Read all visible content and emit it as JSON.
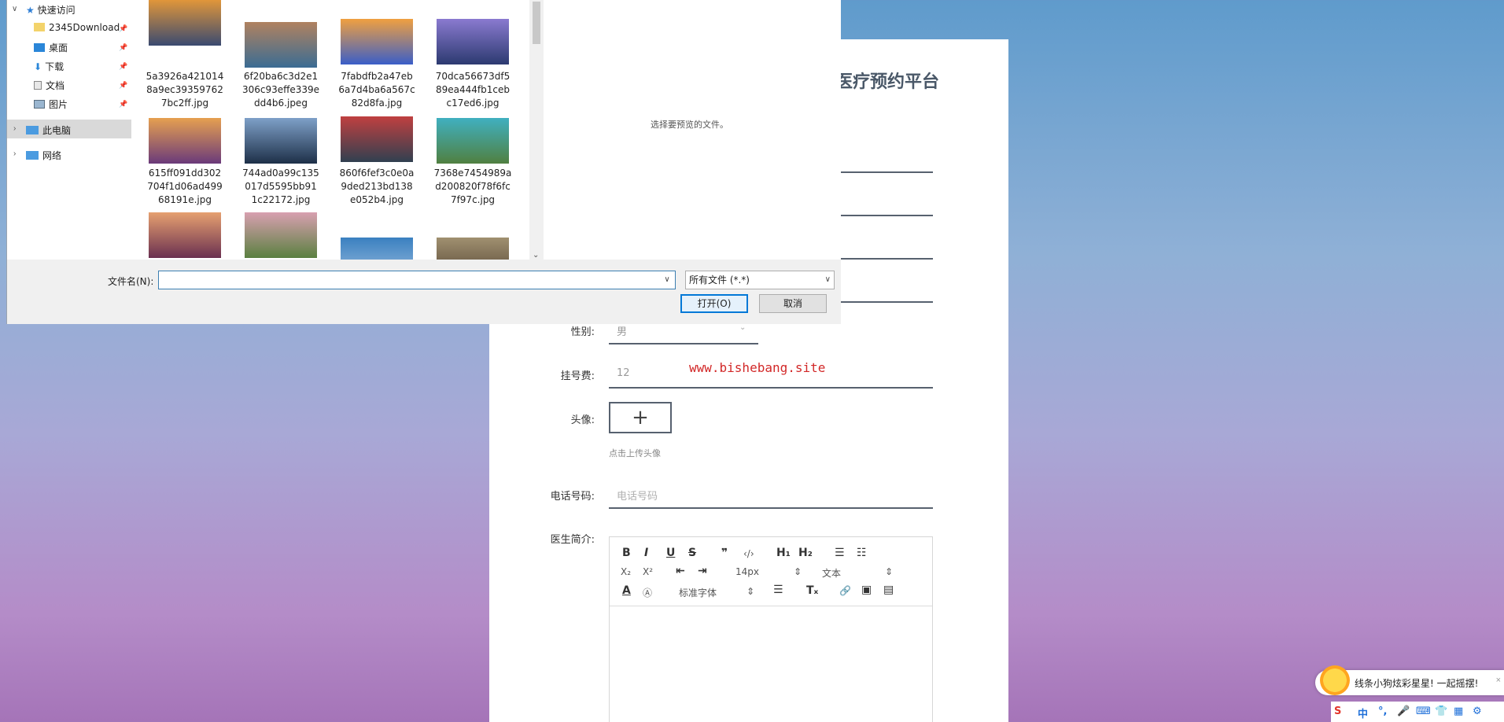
{
  "dialog": {
    "nav": {
      "quick_access": "快速访问",
      "downloads_folder": "2345Download",
      "desktop": "桌面",
      "downloads": "下载",
      "documents": "文档",
      "pictures": "图片",
      "this_pc": "此电脑",
      "network": "网络"
    },
    "files": [
      {
        "name": "5a3926a421014\n8a9ec39359762\n7bc2ff.jpg",
        "color1": "#e0963a",
        "color2": "#3a4a70"
      },
      {
        "name": "6f20ba6c3d2e1\n306c93effe339e\ndd4b6.jpeg",
        "color1": "#b08260",
        "color2": "#3b6c93"
      },
      {
        "name": "7fabdfb2a47eb\n6a7d4ba6a567c\n82d8fa.jpg",
        "color1": "#f0a040",
        "color2": "#3a5ec8"
      },
      {
        "name": "70dca56673df5\n89ea444fb1ceb\nc17ed6.jpg",
        "color1": "#8a7ad0",
        "color2": "#2c3a70"
      },
      {
        "name": "615ff091dd302\n704f1d06ad499\n68191e.jpg",
        "color1": "#e6a050",
        "color2": "#6a3a7a"
      },
      {
        "name": "744ad0a99c135\n017d5595bb91\n1c22172.jpg",
        "color1": "#7ea0c8",
        "color2": "#1e3048"
      },
      {
        "name": "860f6fef3c0e0a\n9ded213bd138\ne052b4.jpg",
        "color1": "#c04040",
        "color2": "#304050"
      },
      {
        "name": "7368e7454989a\nd200820f78f6fc\n7f97c.jpg",
        "color1": "#40b0c0",
        "color2": "#508040"
      },
      {
        "name": "",
        "color1": "#e6a070",
        "color2": "#6a3050"
      },
      {
        "name": "",
        "color1": "#d8a0b0",
        "color2": "#5a8040"
      },
      {
        "name": "",
        "color1": "#3a80c0",
        "color2": "#a0c0e0"
      },
      {
        "name": "",
        "color1": "#a09070",
        "color2": "#504030"
      }
    ],
    "preview_hint": "选择要预览的文件。",
    "filename_label": "文件名(N):",
    "filename_value": "",
    "filter_value": "所有文件 (*.*)",
    "open_button": "打开(O)",
    "cancel_button": "取消"
  },
  "form": {
    "title": "医疗预约平台",
    "gender_label": "性别:",
    "gender_value": "男",
    "fee_label": "挂号费:",
    "fee_value": "12",
    "avatar_label": "头像:",
    "upload_plus": "+",
    "upload_hint": "点击上传头像",
    "phone_label": "电话号码:",
    "phone_placeholder": "电话号码",
    "intro_label": "医生简介:",
    "editor": {
      "bold": "B",
      "italic": "I",
      "underline": "U",
      "strike": "S",
      "quote": "❞",
      "code": "‹/›",
      "h1": "H₁",
      "h2": "H₂",
      "ordered_list": "☰",
      "bullet_list": "☷",
      "subscript": "X₂",
      "superscript": "X²",
      "outdent": "⇤",
      "indent": "⇥",
      "font_size": "14px",
      "header_select": "文本",
      "font_family": "标准字体",
      "align": "☰",
      "clear": "Tₓ",
      "link": "🔗",
      "image": "▣",
      "video": "▤"
    }
  },
  "watermark": "www.bishebang.site",
  "notification": {
    "text": "线条小狗炫彩星星! 一起摇摆!"
  },
  "ime": {
    "logo": "S",
    "mode": "中",
    "punct": "°,"
  }
}
